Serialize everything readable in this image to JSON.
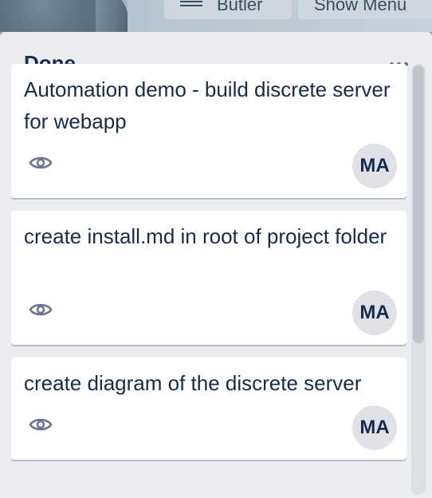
{
  "board_header": {
    "butler_button_label": "Butler",
    "show_menu_button_label": "Show Menu"
  },
  "list": {
    "title": "Done",
    "menu_icon": "ellipsis-icon",
    "cards": [
      {
        "title": "Automation demo - build discrete server for webapp",
        "watch_icon": "eye-icon",
        "member_initials": "MA"
      },
      {
        "title": "create install.md in root of project folder",
        "watch_icon": "eye-icon",
        "member_initials": "MA"
      },
      {
        "title": "create diagram of the discrete server",
        "watch_icon": "eye-icon",
        "member_initials": "MA"
      }
    ]
  },
  "colors": {
    "list_background": "#ebecf0",
    "card_background": "#ffffff",
    "text_primary": "#172b4d",
    "avatar_background": "#dfe1e6"
  }
}
